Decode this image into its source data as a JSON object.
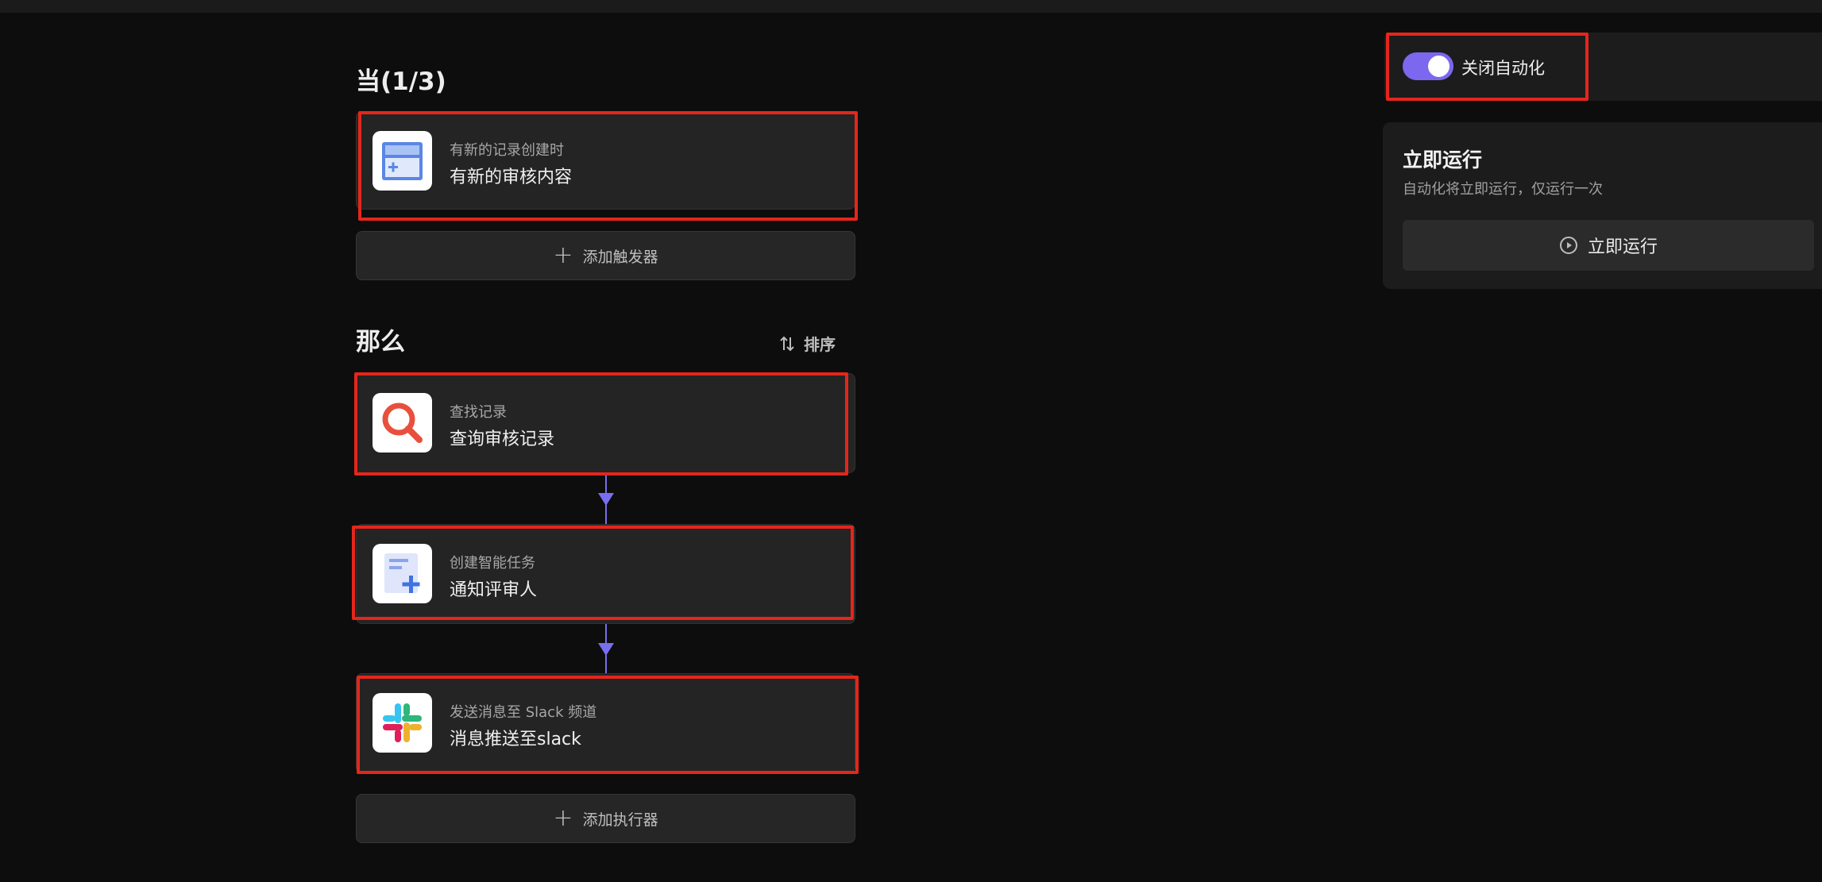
{
  "trigger_section": {
    "title": "当(1/3)",
    "card": {
      "subtitle": "有新的记录创建时",
      "title": "有新的审核内容",
      "icon": "new-record-icon"
    },
    "add_label": "添加触发器"
  },
  "action_section": {
    "title": "那么",
    "sort_label": "排序",
    "cards": [
      {
        "subtitle": "查找记录",
        "title": "查询审核记录",
        "icon": "search-record-icon"
      },
      {
        "subtitle": "创建智能任务",
        "title": "通知评审人",
        "icon": "create-task-icon"
      },
      {
        "subtitle": "发送消息至 Slack 频道",
        "title": "消息推送至slack",
        "icon": "slack-icon"
      }
    ],
    "add_label": "添加执行器"
  },
  "automation_toggle": {
    "label": "关闭自动化",
    "enabled": true
  },
  "run_now": {
    "title": "立即运行",
    "description": "自动化将立即运行，仅运行一次",
    "button_label": "立即运行"
  },
  "colors": {
    "accent": "#7b68ee",
    "highlight": "#e5261b",
    "background": "#0d0d0d",
    "card": "#242424"
  }
}
